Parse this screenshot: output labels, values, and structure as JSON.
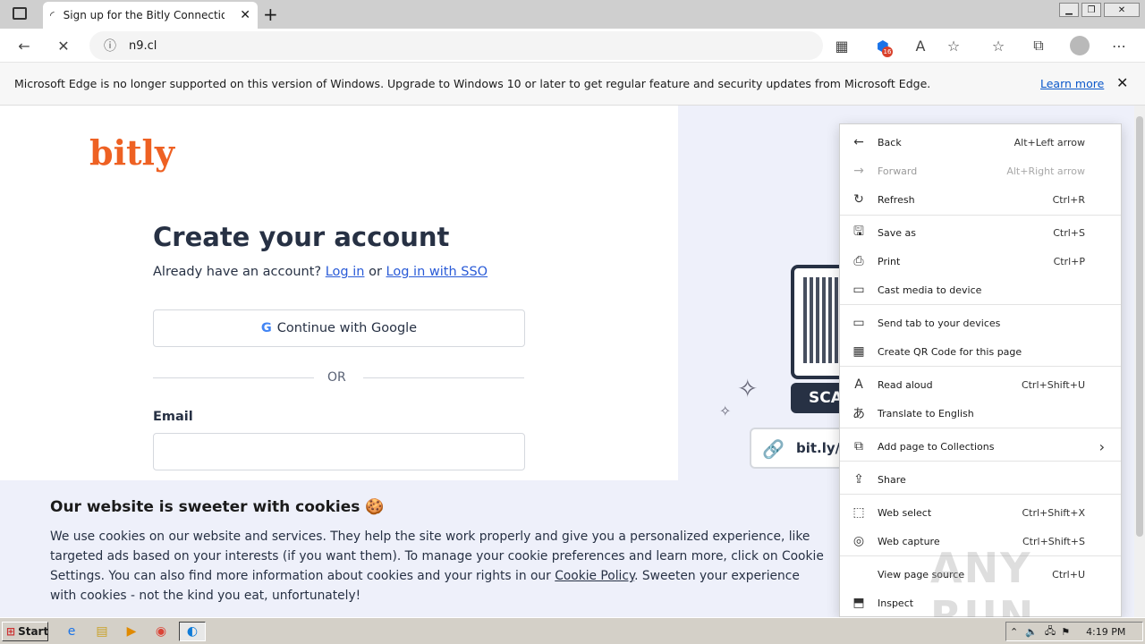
{
  "browser": {
    "tab_title": "Sign up for the Bitly Connections",
    "url": "n9.cl",
    "tracking_badge": "16",
    "infobar_text": "Microsoft Edge is no longer supported on this version of Windows. Upgrade to Windows 10 or later to get regular feature and security updates from Microsoft Edge.",
    "infobar_link": "Learn more"
  },
  "page": {
    "logo": "bitly",
    "heading": "Create your account",
    "have_account": "Already have an account?",
    "login": "Log in",
    "or_word": "or",
    "login_sso": "Log in with SSO",
    "google_button": "Continue with Google",
    "or_divider": "OR",
    "email_label": "Email",
    "scan_text": "SCA",
    "short_link": "bit.ly/S"
  },
  "cookie": {
    "title": "Our website is sweeter with cookies 🍪",
    "body_part1": "We use cookies on our website and services. They help the site work properly and give you a personalized experience, like targeted ads based on your interests (if you want them). To manage your cookie preferences and learn more, click on Cookie Settings. You can also find more information about cookies and your rights in our ",
    "policy_link": "Cookie Policy",
    "body_part2": ". Sweeten your experience with cookies - not the kind you eat, unfortunately!"
  },
  "context_menu": {
    "items": [
      {
        "label": "Back",
        "shortcut": "Alt+Left arrow",
        "icon": "←",
        "disabled": false
      },
      {
        "label": "Forward",
        "shortcut": "Alt+Right arrow",
        "icon": "→",
        "disabled": true
      },
      {
        "label": "Refresh",
        "shortcut": "Ctrl+R",
        "icon": "↻",
        "disabled": false
      },
      {
        "label": "Save as",
        "shortcut": "Ctrl+S",
        "icon": "🖫",
        "disabled": false
      },
      {
        "label": "Print",
        "shortcut": "Ctrl+P",
        "icon": "⎙",
        "disabled": false
      },
      {
        "label": "Cast media to device",
        "shortcut": "",
        "icon": "▭",
        "disabled": false
      },
      {
        "label": "Send tab to your devices",
        "shortcut": "",
        "icon": "▭",
        "disabled": false
      },
      {
        "label": "Create QR Code for this page",
        "shortcut": "",
        "icon": "▦",
        "disabled": false
      },
      {
        "label": "Read aloud",
        "shortcut": "Ctrl+Shift+U",
        "icon": "A",
        "disabled": false
      },
      {
        "label": "Translate to English",
        "shortcut": "",
        "icon": "あ",
        "disabled": false
      },
      {
        "label": "Add page to Collections",
        "shortcut": "›",
        "icon": "⧉",
        "disabled": false
      },
      {
        "label": "Share",
        "shortcut": "",
        "icon": "⇪",
        "disabled": false
      },
      {
        "label": "Web select",
        "shortcut": "Ctrl+Shift+X",
        "icon": "⬚",
        "disabled": false
      },
      {
        "label": "Web capture",
        "shortcut": "Ctrl+Shift+S",
        "icon": "◎",
        "disabled": false
      },
      {
        "label": "View page source",
        "shortcut": "Ctrl+U",
        "icon": "",
        "disabled": false
      },
      {
        "label": "Inspect",
        "shortcut": "",
        "icon": "⬒",
        "disabled": false
      }
    ]
  },
  "taskbar": {
    "start": "Start",
    "clock": "4:19 PM"
  },
  "watermark": "ANY RUN"
}
